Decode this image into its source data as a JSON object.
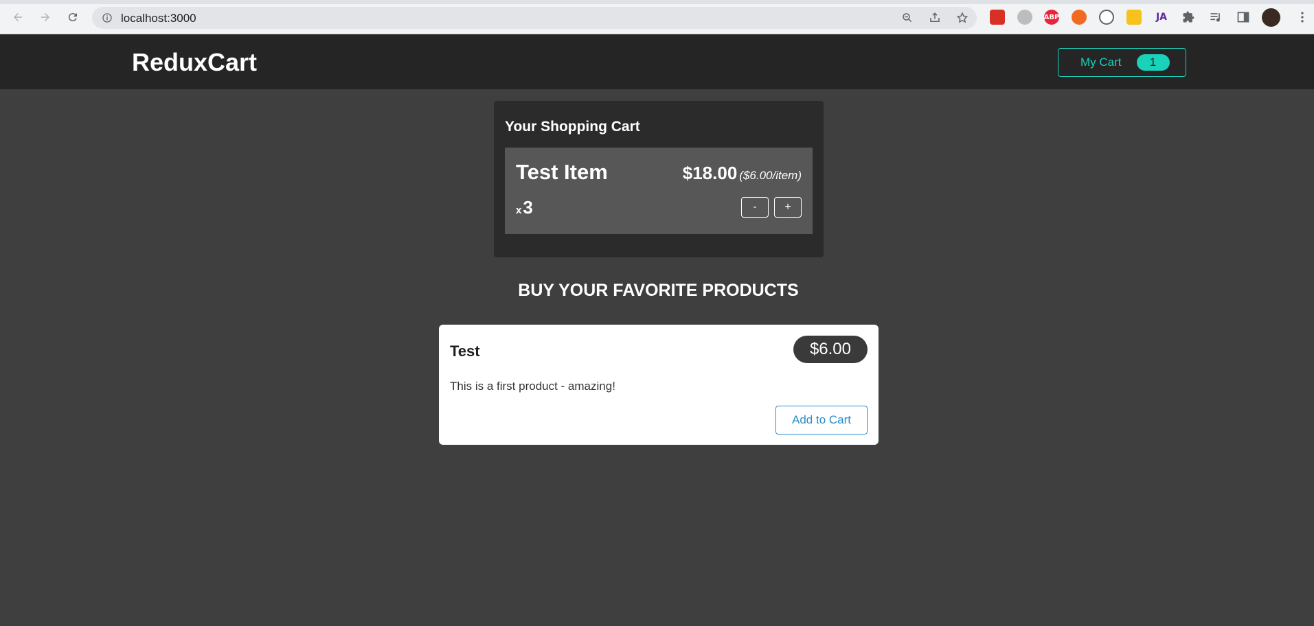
{
  "browser": {
    "url": "localhost:3000",
    "extensions": [
      {
        "name": "red-extension-icon",
        "color": "#d93025"
      },
      {
        "name": "face-extension-icon",
        "color": "#bdbdbd"
      },
      {
        "name": "adblock-extension-icon",
        "color": "#e8243c"
      },
      {
        "name": "orange-extension-icon",
        "color": "#f26922"
      },
      {
        "name": "code-extension-icon",
        "color": "#5f6368"
      },
      {
        "name": "highlighter-extension-icon",
        "color": "#f6c21c"
      },
      {
        "name": "ja-extension-icon",
        "color": "#5b2aa0"
      }
    ]
  },
  "header": {
    "brand": "ReduxCart",
    "cart_label": "My Cart",
    "cart_count": "1"
  },
  "cart": {
    "title": "Your Shopping Cart",
    "items": [
      {
        "name": "Test Item",
        "total": "$18.00",
        "per_item": "($6.00/item)",
        "qty_prefix": "x",
        "quantity": "3",
        "decrement": "-",
        "increment": "+"
      }
    ]
  },
  "products": {
    "heading": "BUY YOUR FAVORITE PRODUCTS",
    "items": [
      {
        "title": "Test",
        "price": "$6.00",
        "description": "This is a first product - amazing!",
        "add_label": "Add to Cart"
      }
    ]
  },
  "colors": {
    "accent": "#1ad1b9",
    "header_bg": "#252525",
    "page_bg": "#3f3f3f",
    "link_blue": "#2a8bcb"
  }
}
